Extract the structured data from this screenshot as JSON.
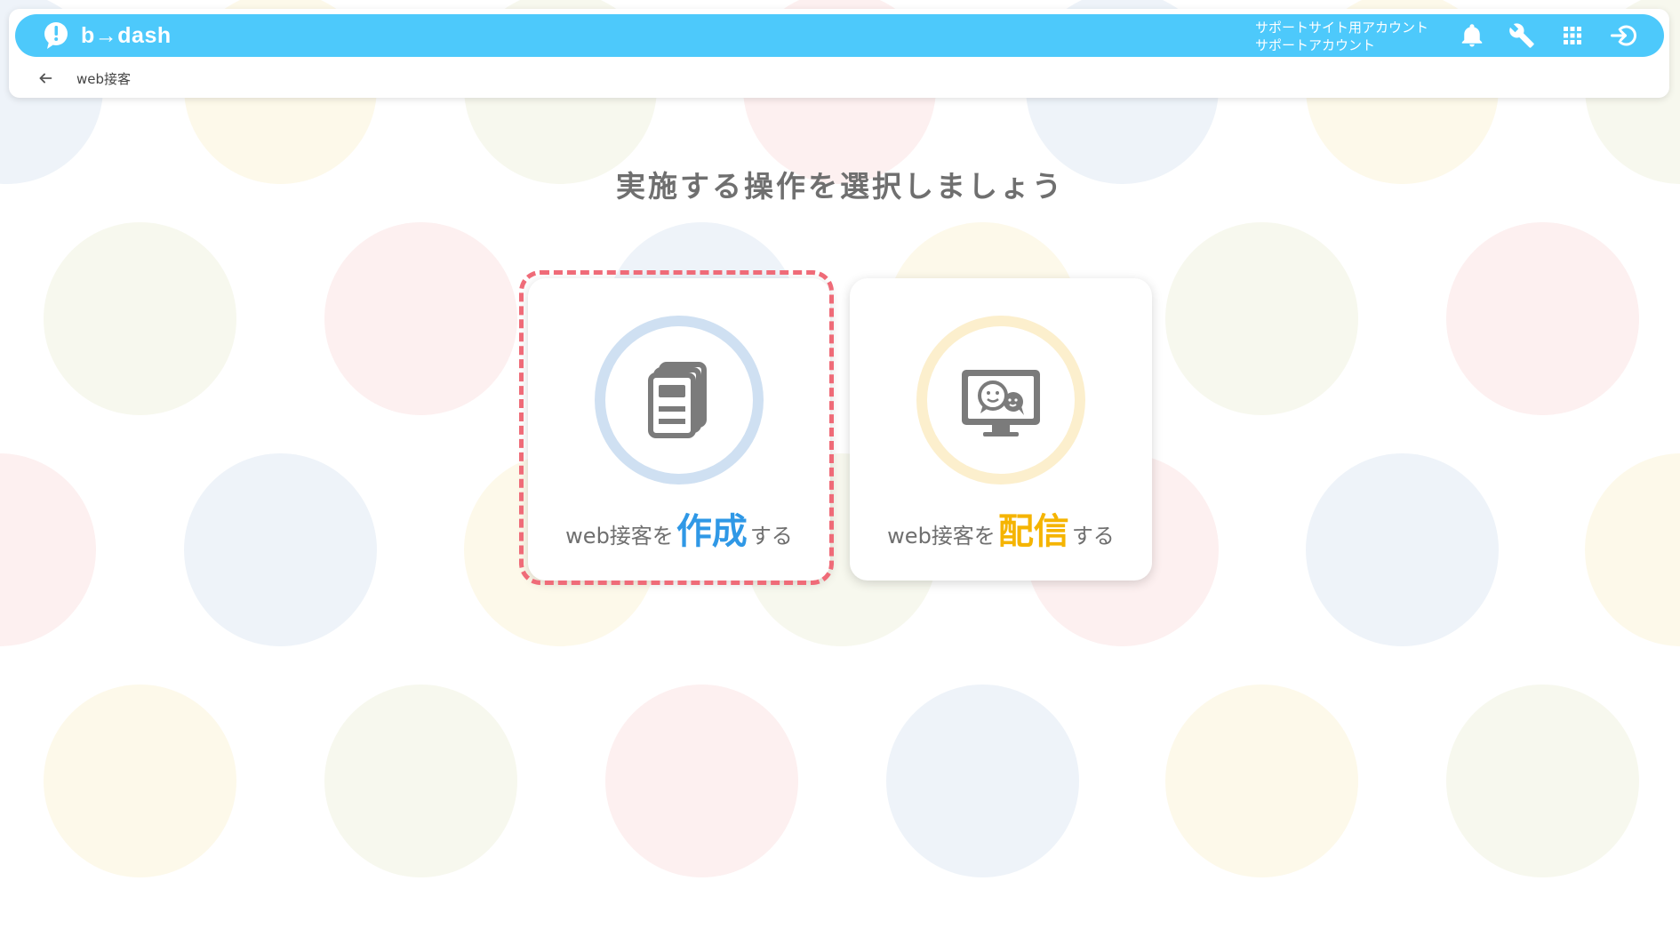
{
  "header": {
    "logo_text": "b→dash",
    "account_line1": "サポートサイト用アカウント",
    "account_line2": "サポートアカウント",
    "icons": [
      "bell-icon",
      "wrench-icon",
      "apps-grid-icon",
      "logout-icon"
    ]
  },
  "breadcrumb": {
    "label": "web接客"
  },
  "main": {
    "title": "実施する操作を選択しましょう",
    "cards": [
      {
        "prefix": "web接客を",
        "emphasis": "作成",
        "suffix": "する",
        "icon": "document-stack-icon",
        "accent_color": "#2f98e6",
        "selected": true
      },
      {
        "prefix": "web接客を",
        "emphasis": "配信",
        "suffix": "する",
        "icon": "monitor-chat-icon",
        "accent_color": "#f5b400",
        "selected": false
      }
    ]
  },
  "colors": {
    "topbar": "#4dc9fb",
    "selection_outline": "#ef6b78",
    "text_gray": "#6f6f6f"
  }
}
